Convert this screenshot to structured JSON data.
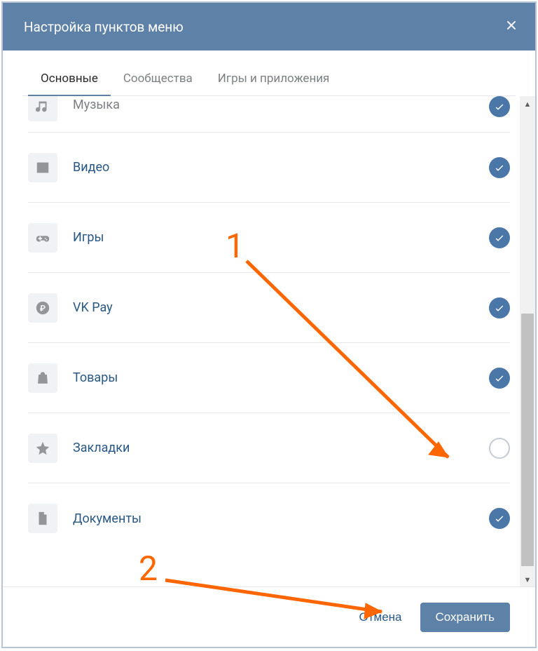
{
  "header": {
    "title": "Настройка пунктов меню"
  },
  "tabs": {
    "items": [
      {
        "label": "Основные",
        "active": true
      },
      {
        "label": "Сообщества",
        "active": false
      },
      {
        "label": "Игры и приложения",
        "active": false
      }
    ]
  },
  "menu_items": [
    {
      "icon": "music-icon",
      "label": "Музыка",
      "checked": true,
      "cut": true
    },
    {
      "icon": "video-icon",
      "label": "Видео",
      "checked": true
    },
    {
      "icon": "gamepad-icon",
      "label": "Игры",
      "checked": true
    },
    {
      "icon": "ruble-icon",
      "label": "VK Pay",
      "checked": true
    },
    {
      "icon": "bag-icon",
      "label": "Товары",
      "checked": true
    },
    {
      "icon": "star-icon",
      "label": "Закладки",
      "checked": false
    },
    {
      "icon": "document-icon",
      "label": "Документы",
      "checked": true
    }
  ],
  "footer": {
    "cancel_label": "Отмена",
    "save_label": "Сохранить"
  },
  "annotations": {
    "step1": "1",
    "step2": "2"
  }
}
